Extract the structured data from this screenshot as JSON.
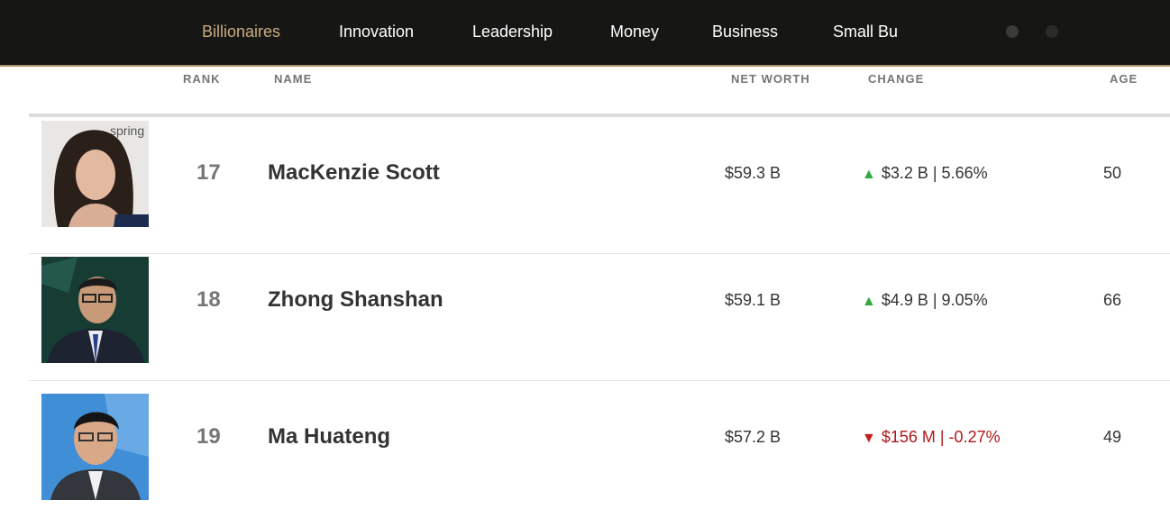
{
  "nav": {
    "items": [
      "Billionaires",
      "Innovation",
      "Leadership",
      "Money",
      "Business"
    ],
    "truncated_item": "Small Business",
    "active_color": "#c9ab80"
  },
  "table": {
    "headers": {
      "rank": "RANK",
      "name": "NAME",
      "net_worth": "NET WORTH",
      "change": "CHANGE",
      "age": "AGE"
    },
    "rows": [
      {
        "rank": "17",
        "name": "MacKenzie Scott",
        "net_worth": "$59.3 B",
        "direction": "up",
        "change": "$3.2 B | 5.66%",
        "age": "50",
        "photo_caption": "spring"
      },
      {
        "rank": "18",
        "name": "Zhong Shanshan",
        "net_worth": "$59.1 B",
        "direction": "up",
        "change": "$4.9 B | 9.05%",
        "age": "66"
      },
      {
        "rank": "19",
        "name": "Ma Huateng",
        "net_worth": "$57.2 B",
        "direction": "down",
        "change": "$156 M | -0.27%",
        "age": "49"
      }
    ]
  },
  "colors": {
    "up": "#2faa3f",
    "down": "#c41d1d",
    "nav_bg": "#161614"
  },
  "icons": {
    "up": "triangle-up-icon",
    "down": "triangle-down-icon"
  }
}
